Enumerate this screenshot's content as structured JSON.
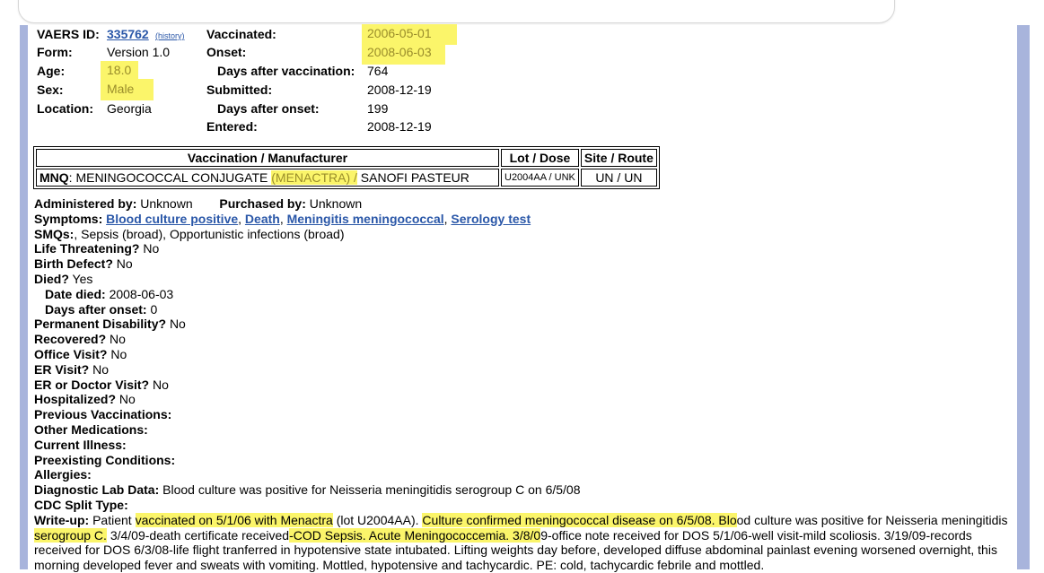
{
  "header": {
    "vaers_id_label": "VAERS ID:",
    "vaers_id_value": "335762",
    "history_link": "(history)",
    "form_label": "Form:",
    "form_value": "Version 1.0",
    "age_label": "Age:",
    "age_value": "18.0",
    "sex_label": "Sex:",
    "sex_value": "Male",
    "location_label": "Location:",
    "location_value": "Georgia",
    "vaccinated_label": "Vaccinated:",
    "vaccinated_value": "2006-05-01",
    "onset_label": "Onset:",
    "onset_value": "2008-06-03",
    "days_after_vax_label": "Days after vaccination:",
    "days_after_vax_value": "764",
    "submitted_label": "Submitted:",
    "submitted_value": "2008-12-19",
    "days_after_onset_label": "Days after onset:",
    "days_after_onset_value": "199",
    "entered_label": "Entered:",
    "entered_value": "2008-12-19"
  },
  "vax_table": {
    "headers": [
      "Vaccination / Manufacturer",
      "Lot / Dose",
      "Site / Route"
    ],
    "row": {
      "code": "MNQ",
      "name_part1": ": MENINGOCOCCAL CONJUGATE ",
      "name_highlight": "(MENACTRA) /",
      "manufacturer": " SANOFI PASTEUR",
      "lot_dose": "U2004AA / UNK",
      "site_route": "UN / UN"
    }
  },
  "details": {
    "administered_label": "Administered by:",
    "administered_value": "Unknown",
    "purchased_label": "Purchased by:",
    "purchased_value": "Unknown",
    "symptoms_label": "Symptoms:",
    "symptoms": [
      "Blood culture positive",
      "Death",
      "Meningitis meningococcal",
      "Serology test"
    ],
    "smqs_label": "SMQs:",
    "smqs_value": ", Sepsis (broad), Opportunistic infections (broad)",
    "life_threatening_label": "Life Threatening?",
    "life_threatening_value": "No",
    "birth_defect_label": "Birth Defect?",
    "birth_defect_value": "No",
    "died_label": "Died?",
    "died_value": "Yes",
    "date_died_label": "Date died:",
    "date_died_value": "2008-06-03",
    "days_after_onset2_label": "Days after onset:",
    "days_after_onset2_value": "0",
    "perm_disability_label": "Permanent Disability?",
    "perm_disability_value": "No",
    "recovered_label": "Recovered?",
    "recovered_value": "No",
    "office_visit_label": "Office Visit?",
    "office_visit_value": "No",
    "er_visit_label": "ER Visit?",
    "er_visit_value": "No",
    "er_doctor_label": "ER or Doctor Visit?",
    "er_doctor_value": "No",
    "hospitalized_label": "Hospitalized?",
    "hospitalized_value": "No",
    "prev_vax_label": "Previous Vaccinations:",
    "other_meds_label": "Other Medications:",
    "current_illness_label": "Current Illness:",
    "preexisting_label": "Preexisting Conditions:",
    "allergies_label": "Allergies:",
    "diag_lab_label": "Diagnostic Lab Data:",
    "diag_lab_value": "Blood culture was positive for Neisseria meningitidis serogroup C on 6/5/08",
    "cdc_split_label": "CDC Split Type:",
    "writeup_label": "Write-up:",
    "writeup_parts": [
      " Patient ",
      "vaccinated on 5/1/06 with Menactra",
      " (lot U2004AA). ",
      "Culture confirmed meningococcal disease on 6/5/08. Blo",
      "od culture was positive for Neisseria meningitidis ",
      "serogroup C.",
      " 3/4/09-death certificate received",
      "-COD Sepsis. Acute Meningococcemia. 3/8/0",
      "9-office note received for DOS 5/1/06-well visit-mild scoliosis. 3/19/09-records received for DOS 6/3/08-life flight tranferred in hypotensive state intubated. Lifting weights day before, developed diffuse abdominal painlast evening worsened overnight, this morning developed fever and sweats with vomiting. Mottled, hypotensive and tachycardic. PE: cold, tachycardic febrile and mottled."
    ]
  }
}
